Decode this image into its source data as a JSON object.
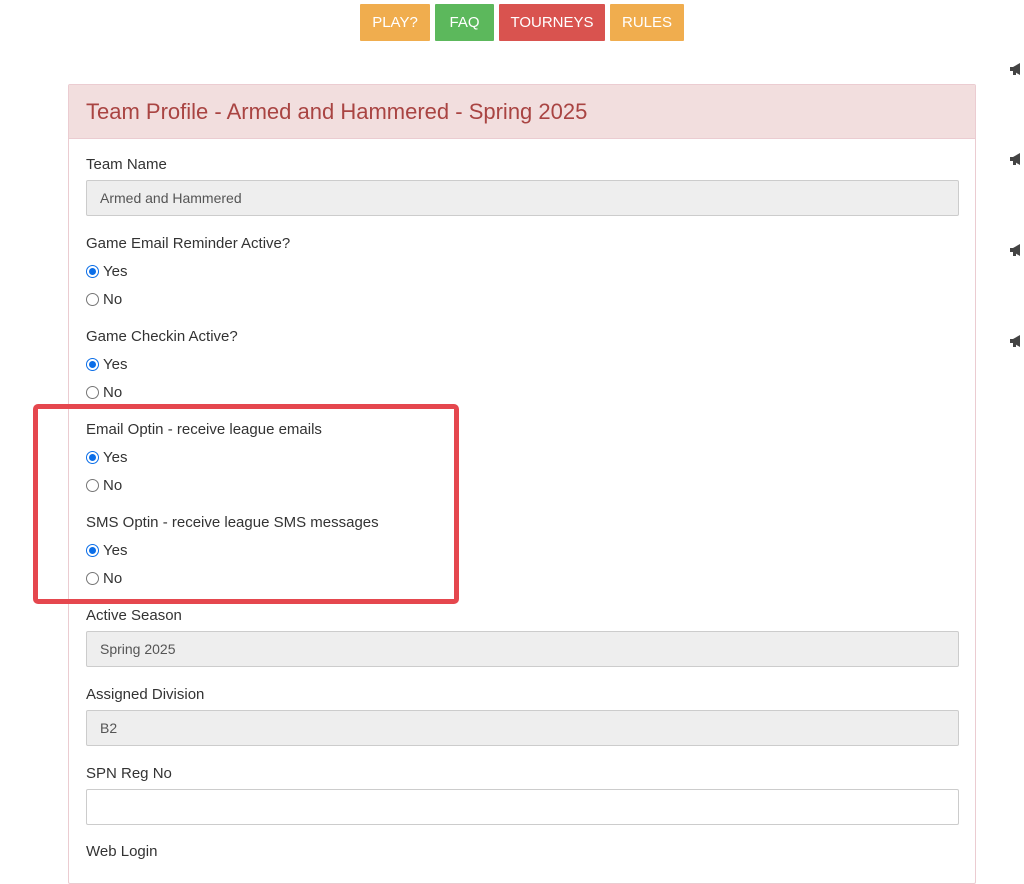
{
  "nav": {
    "play": "PLAY?",
    "faq": "FAQ",
    "tourneys": "TOURNEYS",
    "rules": "RULES"
  },
  "panel": {
    "title": "Team Profile - Armed and Hammered - Spring 2025"
  },
  "fields": {
    "team_name_label": "Team Name",
    "team_name_value": "Armed and Hammered",
    "email_reminder_label": "Game Email Reminder Active?",
    "checkin_label": "Game Checkin Active?",
    "email_optin_label": "Email Optin - receive league emails",
    "sms_optin_label": "SMS Optin - receive league SMS messages",
    "active_season_label": "Active Season",
    "active_season_value": "Spring 2025",
    "division_label": "Assigned Division",
    "division_value": "B2",
    "spn_label": "SPN Reg No",
    "spn_value": "",
    "web_login_label": "Web Login"
  },
  "options": {
    "yes": "Yes",
    "no": "No"
  },
  "selections": {
    "email_reminder": "Yes",
    "checkin": "Yes",
    "email_optin": "Yes",
    "sms_optin": "Yes"
  },
  "colors": {
    "play": "#f0ad4e",
    "faq": "#5cb85c",
    "tourneys": "#d9534f",
    "rules": "#f0ad4e",
    "panel_heading_bg": "#f2dede",
    "panel_heading_text": "#a94442",
    "highlight": "#e5474e",
    "radio_checked": "#0b6ee8"
  },
  "icons": [
    "megaphone-icon",
    "megaphone-icon",
    "megaphone-icon",
    "megaphone-icon"
  ]
}
